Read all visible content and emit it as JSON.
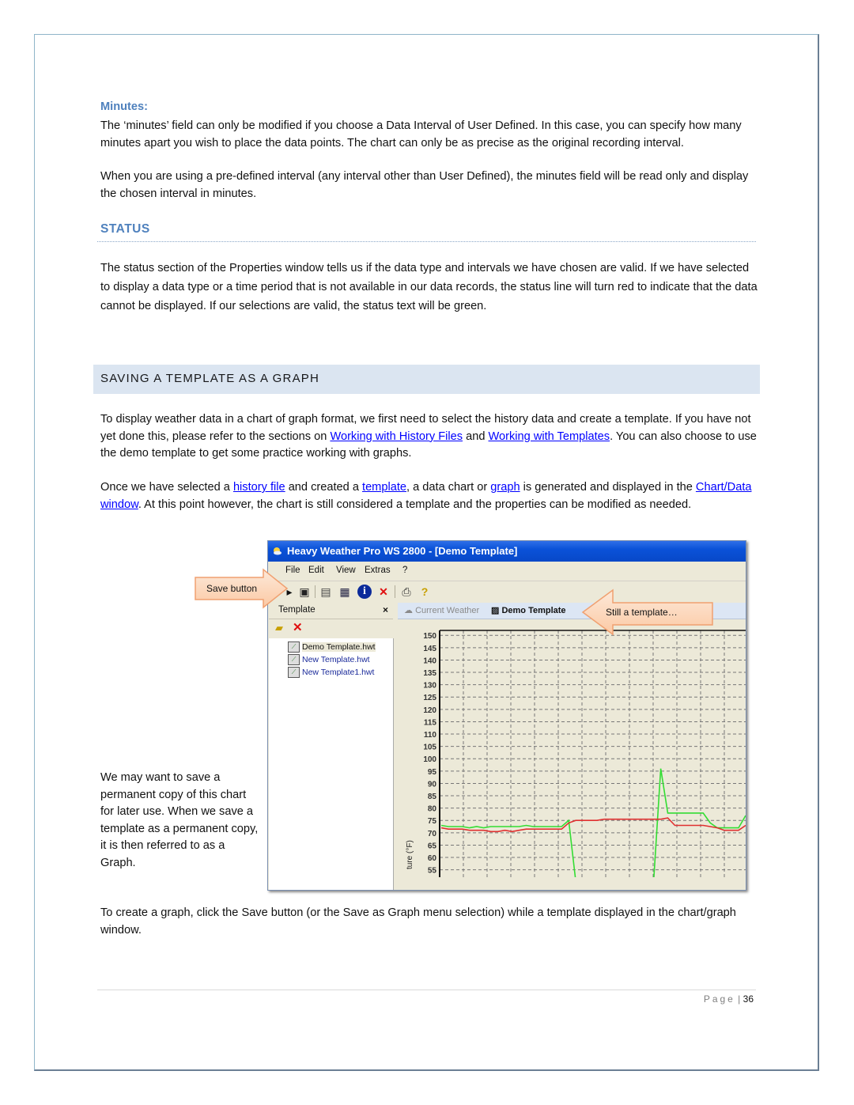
{
  "minutes": {
    "heading": "Minutes:",
    "para1": "The ‘minutes’ field can only be modified if you choose a Data Interval of User Defined. In this case, you can specify how many minutes apart you wish to place the data points. The chart can only be as precise as the original recording interval.",
    "para2": "When you are using a pre-defined interval (any interval other than User Defined), the minutes field will be read only and display the chosen interval in minutes."
  },
  "status": {
    "heading": "STATUS",
    "para": "The status section of the Properties window tells us if the data type and intervals we have chosen are valid. If we have selected to display a data type or a time period that is not available in our data records, the status line will turn red to indicate that the data cannot be displayed. If our selections are valid, the status text will be green."
  },
  "saving": {
    "heading": "SAVING A TEMPLATE AS A GRAPH",
    "p1_a": "To display weather data in a chart of graph format, we first need to select the history data and create a template. If you have not yet done this, please refer to the sections on ",
    "p1_link1": "Working with History Files",
    "p1_b": " and ",
    "p1_link2": "Working with Templates",
    "p1_c": ". You can also choose to use the demo template to get some practice working with graphs.",
    "p2_a": "Once we have selected a ",
    "p2_link1": "history file",
    "p2_b": " and created a ",
    "p2_link2": "template",
    "p2_c": ", a data chart or ",
    "p2_link3": "graph",
    "p2_d": " is generated and displayed in the ",
    "p2_link4": "Chart/Data window",
    "p2_e": ".  At this point however, the chart is still considered a template and the properties can be modified as needed.",
    "side_note": "We may want to save a permanent copy of this chart for later use. When we save a template as a permanent copy, it is then referred to as a Graph.",
    "p3": "To create a graph, click the Save button (or the Save as Graph menu selection) while a template displayed in the chart/graph window."
  },
  "screenshot": {
    "window_title": "Heavy Weather Pro WS 2800 - [Demo Template]",
    "menu": [
      "File",
      "Edit",
      "View",
      "Extras",
      "?"
    ],
    "toolbar_icons": [
      "open-icon",
      "save-icon",
      "properties-icon",
      "export-icon",
      "info-icon",
      "delete-icon",
      "print-icon",
      "help-icon"
    ],
    "pane_title": "Template",
    "pane_close": "×",
    "templates": [
      "Demo Template.hwt",
      "New Template.hwt",
      "New Template1.hwt"
    ],
    "tabs": [
      "Current Weather",
      "Demo Template"
    ],
    "callout_save": "Save button",
    "callout_template": "Still a template…"
  },
  "chart_data": {
    "type": "line",
    "ylabel": "ture (°F)",
    "ylim": [
      52,
      152
    ],
    "yticks": [
      150,
      145,
      140,
      135,
      130,
      125,
      120,
      115,
      110,
      105,
      100,
      95,
      90,
      85,
      80,
      75,
      70,
      65,
      60,
      55
    ],
    "grid": true,
    "series": [
      {
        "name": "green",
        "color": "#33dd33",
        "values": [
          73,
          72.5,
          72.5,
          72.5,
          72,
          72.5,
          72,
          72.5,
          72.5,
          72.5,
          72.5,
          72.5,
          73,
          72.5,
          72.5,
          72.5,
          72.5,
          72.5,
          75,
          30,
          30,
          30,
          30,
          30,
          30,
          30,
          30,
          30,
          30,
          30,
          30,
          96,
          78,
          78,
          78,
          78,
          78,
          78,
          74,
          72,
          72,
          72,
          72,
          77
        ]
      },
      {
        "name": "red",
        "color": "#e03030",
        "values": [
          72,
          71.5,
          71.5,
          71.5,
          71,
          71,
          71,
          70.5,
          70.5,
          71,
          70.5,
          71,
          71.5,
          71.5,
          71.5,
          71.5,
          71.5,
          71.5,
          74,
          75,
          75,
          75,
          75,
          75.5,
          75.5,
          75.5,
          75.5,
          75.5,
          75.5,
          75.5,
          75.5,
          75.5,
          76,
          73,
          73,
          73,
          73,
          73,
          72.5,
          72,
          71,
          71,
          71,
          73
        ]
      }
    ],
    "footer": {
      "page_word": "Page",
      "page_number": "36"
    }
  }
}
